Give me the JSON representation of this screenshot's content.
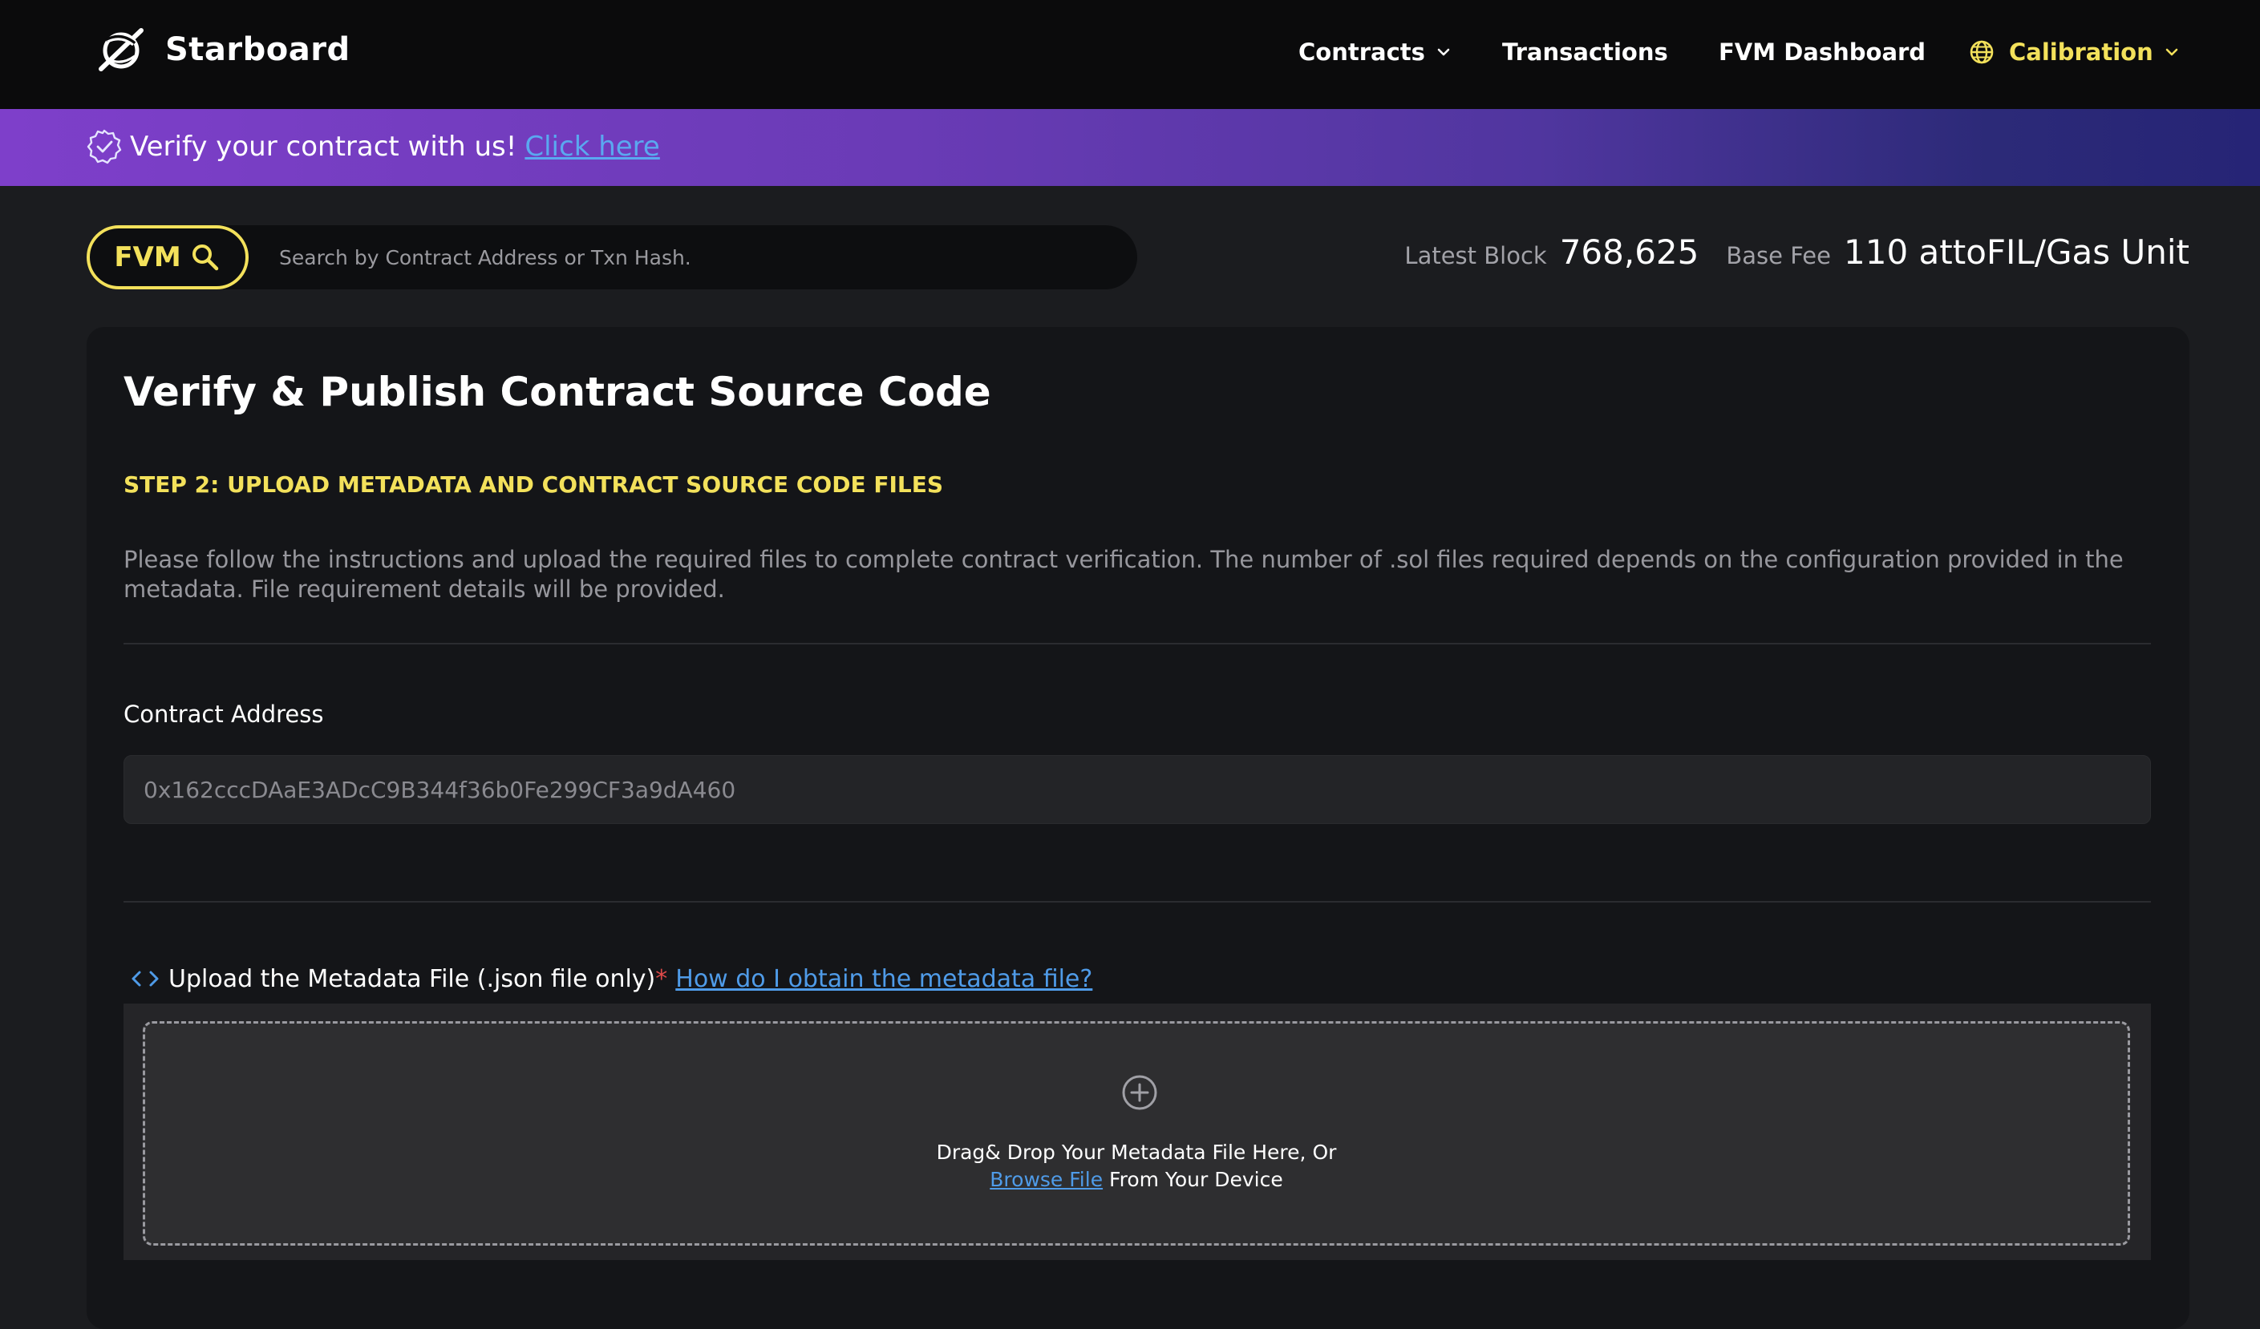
{
  "colors": {
    "accent_yellow": "#f3e15b",
    "link_blue": "#4f9be8",
    "banner_purple": "#7e3fca",
    "banner_indigo": "#262476",
    "required_red": "#e04a4a",
    "background": "#1b1c1f"
  },
  "brand": {
    "name": "Starboard",
    "logo_icon": "starboard-logo-icon"
  },
  "nav": {
    "contracts": "Contracts",
    "transactions": "Transactions",
    "fvm_dashboard": "FVM Dashboard",
    "network": "Calibration"
  },
  "banner": {
    "text": "Verify your contract with us!",
    "link": "Click here",
    "icon": "verified-badge-icon"
  },
  "search": {
    "scope": "FVM",
    "placeholder": "Search by Contract Address or Txn Hash.",
    "icon": "search-icon"
  },
  "stats": {
    "latest_block_label": "Latest Block",
    "latest_block_value": "768,625",
    "base_fee_label": "Base Fee",
    "base_fee_value": "110 attoFIL/Gas Unit"
  },
  "main": {
    "title": "Verify & Publish Contract Source Code",
    "step": "STEP 2: UPLOAD METADATA AND CONTRACT SOURCE CODE FILES",
    "instructions": "Please follow the instructions and upload the required files to complete contract verification. The number of .sol files required depends on the configuration provided in the metadata. File requirement details will be provided.",
    "contract_address_label": "Contract Address",
    "contract_address_value": "0x162cccDAaE3ADcC9B344f36b0Fe299CF3a9dA460",
    "upload_label": "Upload the Metadata File (.json file only)",
    "required_marker": "*",
    "upload_help_link": "How do I obtain the metadata file?",
    "dropzone_line1": "Drag& Drop Your Metadata File Here, Or",
    "dropzone_browse": "Browse File",
    "dropzone_line2_suffix": " From Your Device"
  }
}
